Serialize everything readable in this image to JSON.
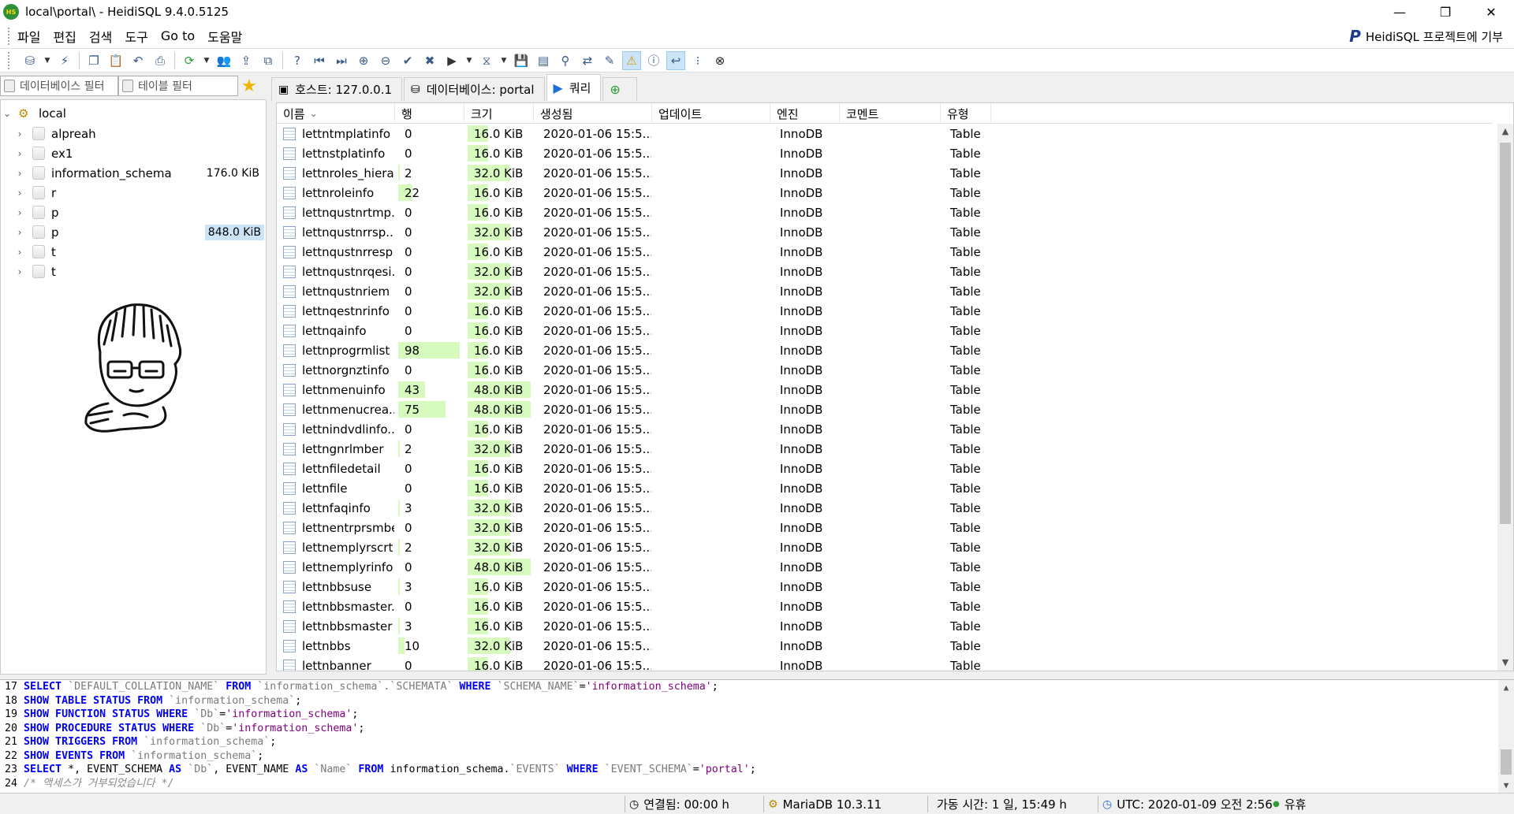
{
  "window": {
    "title": "local\\portal\\ - HeidiSQL 9.4.0.5125",
    "app_icon_text": "HS",
    "minimize": "—",
    "restore": "❐",
    "close": "✕"
  },
  "menu": {
    "items": [
      "파일",
      "편집",
      "검색",
      "도구",
      "Go to",
      "도움말"
    ],
    "donate": "HeidiSQL 프로젝트에 기부",
    "donate_icon": "P"
  },
  "filters": {
    "db_filter": "데이터베이스 필터",
    "table_filter": "테이블 필터"
  },
  "tabs": [
    {
      "label": "호스트: 127.0.0.1",
      "icon": "host-icon"
    },
    {
      "label": "데이터베이스: portal",
      "icon": "database-icon"
    },
    {
      "label": "쿼리",
      "icon": "play-icon"
    },
    {
      "label": "",
      "icon": "new-query-tab-icon"
    }
  ],
  "tree": {
    "root": "local",
    "items": [
      {
        "label": "alpreah",
        "size": ""
      },
      {
        "label": "ex1",
        "size": ""
      },
      {
        "label": "information_schema",
        "size": "176.0 KiB"
      },
      {
        "label": "r",
        "size": ""
      },
      {
        "label": "p",
        "size": ""
      },
      {
        "label": "p",
        "size": "848.0 KiB"
      },
      {
        "label": "t",
        "size": ""
      },
      {
        "label": "t",
        "size": ""
      }
    ]
  },
  "grid": {
    "columns": [
      "이름",
      "행",
      "크기",
      "생성됨",
      "업데이트",
      "엔진",
      "코멘트",
      "유형"
    ],
    "sort_icon": "⌄",
    "rows": [
      {
        "name": "lettntmplatinfo",
        "rows": "0",
        "size": "16.0 KiB",
        "created": "2020-01-06 15:5...",
        "updated": "",
        "engine": "InnoDB",
        "comment": "",
        "type": "Table",
        "rows_fill": 0.0,
        "size_fill": 0.33
      },
      {
        "name": "lettnstplatinfo",
        "rows": "0",
        "size": "16.0 KiB",
        "created": "2020-01-06 15:5...",
        "updated": "",
        "engine": "InnoDB",
        "comment": "",
        "type": "Table",
        "rows_fill": 0.0,
        "size_fill": 0.33
      },
      {
        "name": "lettnroles_hiera...",
        "rows": "2",
        "size": "32.0 KiB",
        "created": "2020-01-06 15:5...",
        "updated": "",
        "engine": "InnoDB",
        "comment": "",
        "type": "Table",
        "rows_fill": 0.02,
        "size_fill": 0.67
      },
      {
        "name": "lettnroleinfo",
        "rows": "22",
        "size": "16.0 KiB",
        "created": "2020-01-06 15:5...",
        "updated": "",
        "engine": "InnoDB",
        "comment": "",
        "type": "Table",
        "rows_fill": 0.22,
        "size_fill": 0.33
      },
      {
        "name": "lettnqustnrtmp...",
        "rows": "0",
        "size": "16.0 KiB",
        "created": "2020-01-06 15:5...",
        "updated": "",
        "engine": "InnoDB",
        "comment": "",
        "type": "Table",
        "rows_fill": 0.0,
        "size_fill": 0.33
      },
      {
        "name": "lettnqustnrrsp...",
        "rows": "0",
        "size": "32.0 KiB",
        "created": "2020-01-06 15:5...",
        "updated": "",
        "engine": "InnoDB",
        "comment": "",
        "type": "Table",
        "rows_fill": 0.0,
        "size_fill": 0.67
      },
      {
        "name": "lettnqustnrresp...",
        "rows": "0",
        "size": "16.0 KiB",
        "created": "2020-01-06 15:5...",
        "updated": "",
        "engine": "InnoDB",
        "comment": "",
        "type": "Table",
        "rows_fill": 0.0,
        "size_fill": 0.33
      },
      {
        "name": "lettnqustnrqesi...",
        "rows": "0",
        "size": "32.0 KiB",
        "created": "2020-01-06 15:5...",
        "updated": "",
        "engine": "InnoDB",
        "comment": "",
        "type": "Table",
        "rows_fill": 0.0,
        "size_fill": 0.67
      },
      {
        "name": "lettnqustnriem",
        "rows": "0",
        "size": "32.0 KiB",
        "created": "2020-01-06 15:5...",
        "updated": "",
        "engine": "InnoDB",
        "comment": "",
        "type": "Table",
        "rows_fill": 0.0,
        "size_fill": 0.67
      },
      {
        "name": "lettnqestnrinfo",
        "rows": "0",
        "size": "16.0 KiB",
        "created": "2020-01-06 15:5...",
        "updated": "",
        "engine": "InnoDB",
        "comment": "",
        "type": "Table",
        "rows_fill": 0.0,
        "size_fill": 0.33
      },
      {
        "name": "lettnqainfo",
        "rows": "0",
        "size": "16.0 KiB",
        "created": "2020-01-06 15:5...",
        "updated": "",
        "engine": "InnoDB",
        "comment": "",
        "type": "Table",
        "rows_fill": 0.0,
        "size_fill": 0.33
      },
      {
        "name": "lettnprogrmlist",
        "rows": "98",
        "size": "16.0 KiB",
        "created": "2020-01-06 15:5...",
        "updated": "",
        "engine": "InnoDB",
        "comment": "",
        "type": "Table",
        "rows_fill": 0.98,
        "size_fill": 0.33
      },
      {
        "name": "lettnorgnztinfo",
        "rows": "0",
        "size": "16.0 KiB",
        "created": "2020-01-06 15:5...",
        "updated": "",
        "engine": "InnoDB",
        "comment": "",
        "type": "Table",
        "rows_fill": 0.0,
        "size_fill": 0.33
      },
      {
        "name": "lettnmenuinfo",
        "rows": "43",
        "size": "48.0 KiB",
        "created": "2020-01-06 15:5...",
        "updated": "",
        "engine": "InnoDB",
        "comment": "",
        "type": "Table",
        "rows_fill": 0.43,
        "size_fill": 1.0
      },
      {
        "name": "lettnmenucrea...",
        "rows": "75",
        "size": "48.0 KiB",
        "created": "2020-01-06 15:5...",
        "updated": "",
        "engine": "InnoDB",
        "comment": "",
        "type": "Table",
        "rows_fill": 0.75,
        "size_fill": 1.0
      },
      {
        "name": "lettnindvdlinfo...",
        "rows": "0",
        "size": "16.0 KiB",
        "created": "2020-01-06 15:5...",
        "updated": "",
        "engine": "InnoDB",
        "comment": "",
        "type": "Table",
        "rows_fill": 0.0,
        "size_fill": 0.33
      },
      {
        "name": "lettngnrlmber",
        "rows": "2",
        "size": "32.0 KiB",
        "created": "2020-01-06 15:5...",
        "updated": "",
        "engine": "InnoDB",
        "comment": "",
        "type": "Table",
        "rows_fill": 0.02,
        "size_fill": 0.67
      },
      {
        "name": "lettnfiledetail",
        "rows": "0",
        "size": "16.0 KiB",
        "created": "2020-01-06 15:5...",
        "updated": "",
        "engine": "InnoDB",
        "comment": "",
        "type": "Table",
        "rows_fill": 0.0,
        "size_fill": 0.33
      },
      {
        "name": "lettnfile",
        "rows": "0",
        "size": "16.0 KiB",
        "created": "2020-01-06 15:5...",
        "updated": "",
        "engine": "InnoDB",
        "comment": "",
        "type": "Table",
        "rows_fill": 0.0,
        "size_fill": 0.33
      },
      {
        "name": "lettnfaqinfo",
        "rows": "3",
        "size": "32.0 KiB",
        "created": "2020-01-06 15:5...",
        "updated": "",
        "engine": "InnoDB",
        "comment": "",
        "type": "Table",
        "rows_fill": 0.03,
        "size_fill": 0.67
      },
      {
        "name": "lettnentrprsmber",
        "rows": "0",
        "size": "32.0 KiB",
        "created": "2020-01-06 15:5...",
        "updated": "",
        "engine": "InnoDB",
        "comment": "",
        "type": "Table",
        "rows_fill": 0.0,
        "size_fill": 0.67
      },
      {
        "name": "lettnemplyrscrt...",
        "rows": "2",
        "size": "32.0 KiB",
        "created": "2020-01-06 15:5...",
        "updated": "",
        "engine": "InnoDB",
        "comment": "",
        "type": "Table",
        "rows_fill": 0.02,
        "size_fill": 0.67
      },
      {
        "name": "lettnemplyrinfo",
        "rows": "0",
        "size": "48.0 KiB",
        "created": "2020-01-06 15:5...",
        "updated": "",
        "engine": "InnoDB",
        "comment": "",
        "type": "Table",
        "rows_fill": 0.0,
        "size_fill": 1.0
      },
      {
        "name": "lettnbbsuse",
        "rows": "3",
        "size": "16.0 KiB",
        "created": "2020-01-06 15:5...",
        "updated": "",
        "engine": "InnoDB",
        "comment": "",
        "type": "Table",
        "rows_fill": 0.03,
        "size_fill": 0.33
      },
      {
        "name": "lettnbbsmaster...",
        "rows": "0",
        "size": "16.0 KiB",
        "created": "2020-01-06 15:5...",
        "updated": "",
        "engine": "InnoDB",
        "comment": "",
        "type": "Table",
        "rows_fill": 0.0,
        "size_fill": 0.33
      },
      {
        "name": "lettnbbsmaster",
        "rows": "3",
        "size": "16.0 KiB",
        "created": "2020-01-06 15:5...",
        "updated": "",
        "engine": "InnoDB",
        "comment": "",
        "type": "Table",
        "rows_fill": 0.03,
        "size_fill": 0.33
      },
      {
        "name": "lettnbbs",
        "rows": "10",
        "size": "32.0 KiB",
        "created": "2020-01-06 15:5...",
        "updated": "",
        "engine": "InnoDB",
        "comment": "",
        "type": "Table",
        "rows_fill": 0.1,
        "size_fill": 0.67
      },
      {
        "name": "lettnbanner",
        "rows": "0",
        "size": "16.0 KiB",
        "created": "2020-01-06 15:5...",
        "updated": "",
        "engine": "InnoDB",
        "comment": "",
        "type": "Table",
        "rows_fill": 0.0,
        "size_fill": 0.33
      }
    ]
  },
  "sql_log": [
    [
      [
        "ln",
        "17 "
      ],
      [
        "kw",
        "SELECT"
      ],
      [
        "t",
        " "
      ],
      [
        "id",
        "`DEFAULT_COLLATION_NAME`"
      ],
      [
        "t",
        " "
      ],
      [
        "kw",
        "FROM"
      ],
      [
        "t",
        " "
      ],
      [
        "id",
        "`information_schema`.`SCHEMATA`"
      ],
      [
        "t",
        " "
      ],
      [
        "kw",
        "WHERE"
      ],
      [
        "t",
        " "
      ],
      [
        "id",
        "`SCHEMA_NAME`"
      ],
      [
        "t",
        "="
      ],
      [
        "str",
        "'information_schema'"
      ],
      [
        "t",
        ";"
      ]
    ],
    [
      [
        "ln",
        "18 "
      ],
      [
        "kw",
        "SHOW TABLE STATUS FROM"
      ],
      [
        "t",
        " "
      ],
      [
        "id",
        "`information_schema`"
      ],
      [
        "t",
        ";"
      ]
    ],
    [
      [
        "ln",
        "19 "
      ],
      [
        "kw",
        "SHOW FUNCTION STATUS WHERE"
      ],
      [
        "t",
        " "
      ],
      [
        "id",
        "`Db`"
      ],
      [
        "t",
        "="
      ],
      [
        "str",
        "'information_schema'"
      ],
      [
        "t",
        ";"
      ]
    ],
    [
      [
        "ln",
        "20 "
      ],
      [
        "kw",
        "SHOW PROCEDURE STATUS WHERE"
      ],
      [
        "t",
        " "
      ],
      [
        "id",
        "`Db`"
      ],
      [
        "t",
        "="
      ],
      [
        "str",
        "'information_schema'"
      ],
      [
        "t",
        ";"
      ]
    ],
    [
      [
        "ln",
        "21 "
      ],
      [
        "kw",
        "SHOW TRIGGERS FROM"
      ],
      [
        "t",
        " "
      ],
      [
        "id",
        "`information_schema`"
      ],
      [
        "t",
        ";"
      ]
    ],
    [
      [
        "ln",
        "22 "
      ],
      [
        "kw",
        "SHOW EVENTS FROM"
      ],
      [
        "t",
        " "
      ],
      [
        "id",
        "`information_schema`"
      ],
      [
        "t",
        ";"
      ]
    ],
    [
      [
        "ln",
        "23 "
      ],
      [
        "kw",
        "SELECT"
      ],
      [
        "t",
        " *, EVENT_SCHEMA "
      ],
      [
        "kw",
        "AS"
      ],
      [
        "t",
        " "
      ],
      [
        "id",
        "`Db`"
      ],
      [
        "t",
        ", EVENT_NAME "
      ],
      [
        "kw",
        "AS"
      ],
      [
        "t",
        " "
      ],
      [
        "id",
        "`Name`"
      ],
      [
        "t",
        " "
      ],
      [
        "kw",
        "FROM"
      ],
      [
        "t",
        " information_schema."
      ],
      [
        "id",
        "`EVENTS`"
      ],
      [
        "t",
        " "
      ],
      [
        "kw",
        "WHERE"
      ],
      [
        "t",
        " "
      ],
      [
        "id",
        "`EVENT_SCHEMA`"
      ],
      [
        "t",
        "="
      ],
      [
        "str",
        "'portal'"
      ],
      [
        "t",
        ";"
      ]
    ],
    [
      [
        "ln",
        "24 "
      ],
      [
        "cm",
        "/* 액세스가 거부되었습니다 */"
      ]
    ]
  ],
  "status": {
    "connected": "연결됨: 00:00 h",
    "server": "MariaDB 10.3.11",
    "uptime": "가동 시간: 1 일, 15:49 h",
    "utc": "UTC: 2020-01-09 오전 2:56",
    "idle": "유휴"
  },
  "colors": {
    "bar_fill": "#d7fbbf",
    "selection": "#cce4f7",
    "keyword": "#0000ff",
    "string": "#800080"
  }
}
